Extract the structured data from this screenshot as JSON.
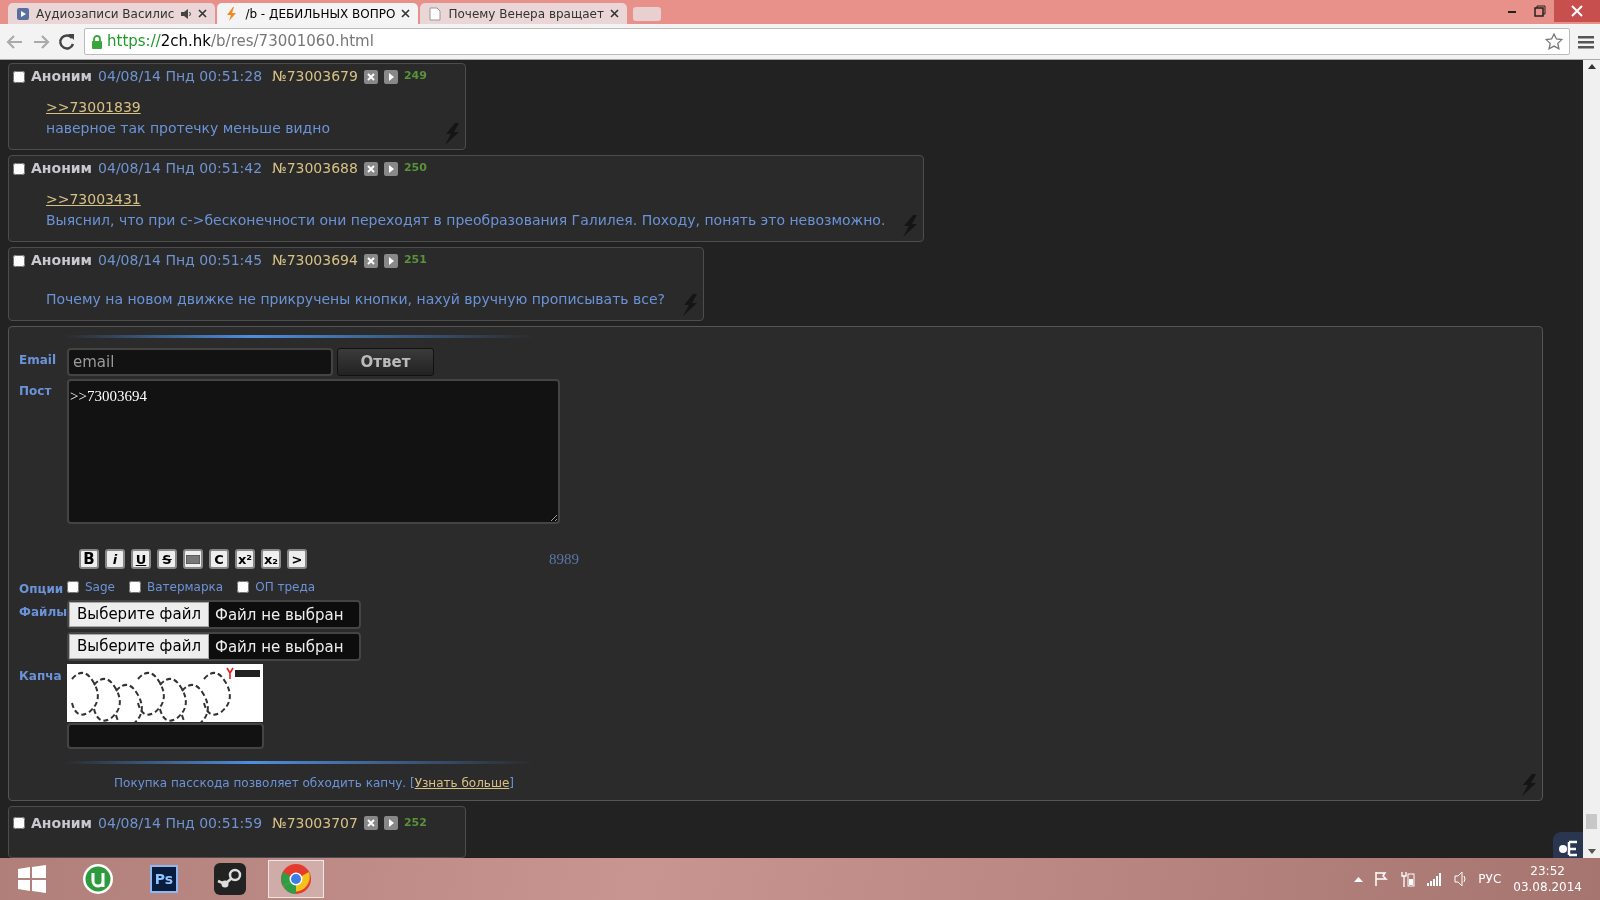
{
  "browser": {
    "tabs": [
      {
        "title": "Аудиозаписи Василис",
        "kind": "audio-page",
        "selected": false,
        "playing_sound": true
      },
      {
        "title": "/b - ДЕБИЛЬНЫХ ВОПРО",
        "kind": "bolt-page",
        "selected": true,
        "playing_sound": false
      },
      {
        "title": "Почему Венера вращает",
        "kind": "doc-page",
        "selected": false,
        "playing_sound": false
      }
    ],
    "address": {
      "scheme": "https://",
      "host": "2ch.hk",
      "path": "/b/res/73001060.html"
    }
  },
  "posts": [
    {
      "name": "Аноним",
      "date": "04/08/14 Пнд 00:51:28",
      "number": "№73003679",
      "count": "249",
      "checked": false,
      "reply_link": ">>73001839",
      "text": "наверное так протечку меньше видно"
    },
    {
      "name": "Аноним",
      "date": "04/08/14 Пнд 00:51:42",
      "number": "№73003688",
      "count": "250",
      "checked": false,
      "reply_link": ">>73003431",
      "text": "Выяснил, что при c->бесконечности они переходят в преобразования Галилея. Походу, понять это невозможно."
    },
    {
      "name": "Аноним",
      "date": "04/08/14 Пнд 00:51:45",
      "number": "№73003694",
      "count": "251",
      "checked": false,
      "text": "Почему на новом движке не прикручены кнопки, нахуй вручную прописывать все?"
    }
  ],
  "form": {
    "email_label": "Email",
    "email_placeholder": "email",
    "submit": "Ответ",
    "post_label": "Пост",
    "post_value": ">>73003694",
    "markup_buttons": [
      {
        "kind": "bold",
        "glyph": "B"
      },
      {
        "kind": "italic",
        "glyph": "i"
      },
      {
        "kind": "underline",
        "glyph": "U"
      },
      {
        "kind": "strike",
        "glyph": "S"
      },
      {
        "kind": "spoiler"
      },
      {
        "kind": "plain",
        "glyph": "C"
      },
      {
        "kind": "plain",
        "glyph": "x²"
      },
      {
        "kind": "plain",
        "glyph": "x₂"
      },
      {
        "kind": "plain",
        "glyph": ">"
      }
    ],
    "counter": "8989",
    "options_label": "Опции",
    "options": [
      {
        "label": "Sage",
        "checked": false
      },
      {
        "label": "Ватермарка",
        "checked": false
      },
      {
        "label": "ОП треда",
        "checked": false
      }
    ],
    "files_label": "Файлы",
    "files": [
      {
        "button": "Выберите файл",
        "status": "Файл не выбран"
      },
      {
        "button": "Выберите файл",
        "status": "Файл не выбран"
      }
    ],
    "captcha_label": "Капча",
    "note": "Покупка пасскода позволяет обходить капчу. [",
    "note_link": "Узнать больше",
    "note_end": "]"
  },
  "next_post": {
    "name": "Аноним",
    "date": "04/08/14 Пнд 00:51:59",
    "number": "№73003707",
    "count": "252",
    "checked": false
  },
  "taskbar": {
    "apps": [
      {
        "kind": "torrent",
        "selected": false
      },
      {
        "kind": "photo",
        "glyph": "Ps",
        "selected": false
      },
      {
        "kind": "steam",
        "selected": false
      },
      {
        "kind": "browser",
        "selected": true
      }
    ],
    "language": "РУС",
    "time": "23:52",
    "date": "03.08.2014"
  }
}
